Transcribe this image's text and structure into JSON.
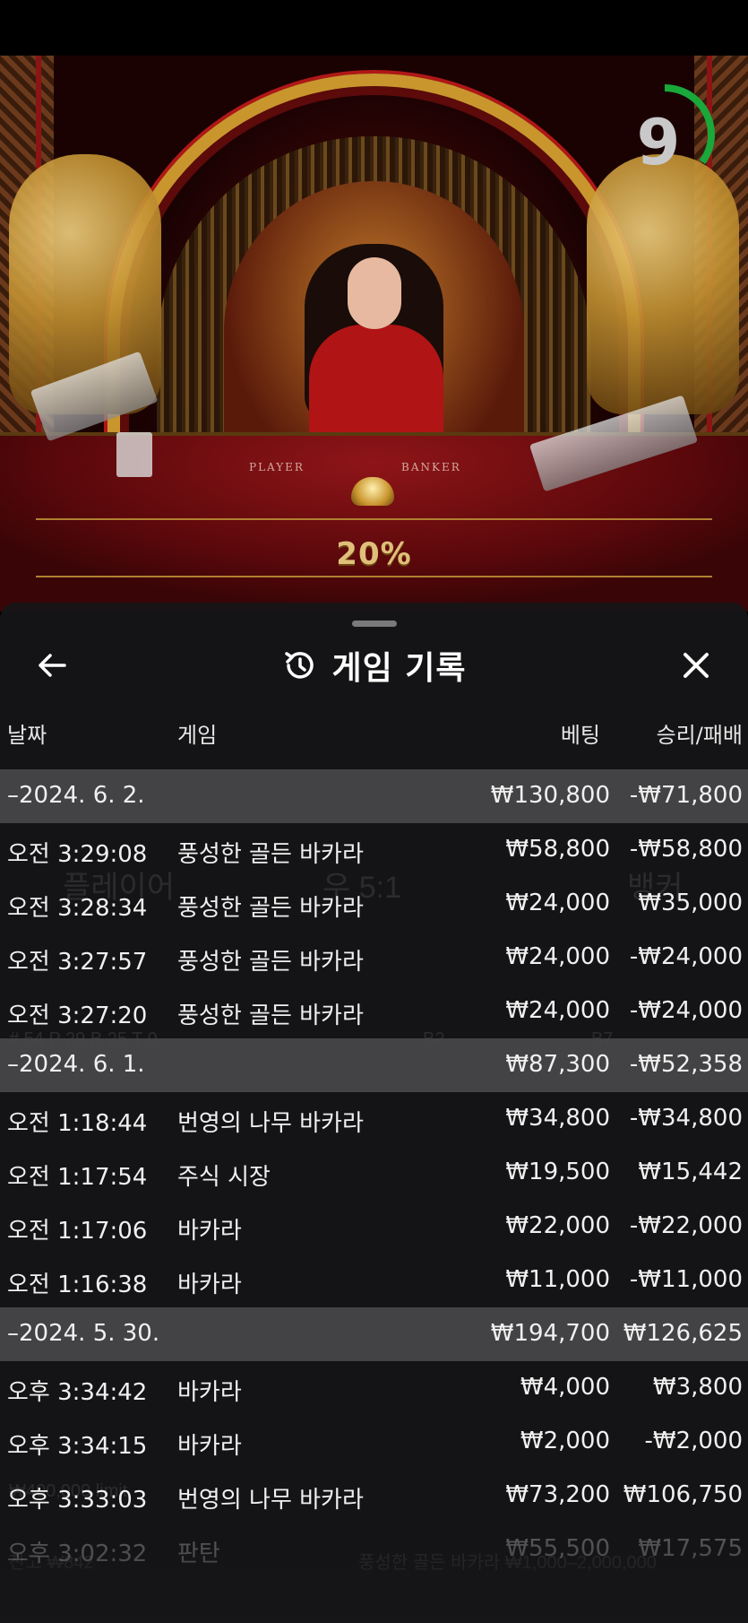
{
  "video": {
    "table_left_label": "PLAYER",
    "table_right_label": "BANKER",
    "bonus_label": "20%",
    "timer_value": "9",
    "timer_progress": 0.35,
    "timer_color": "#19a83a"
  },
  "history": {
    "title": "게임 기록",
    "columns": {
      "date": "날짜",
      "game": "게임",
      "bet": "베팅",
      "win_loss": "승리/패배"
    },
    "rows": [
      {
        "type": "group",
        "date": "–2024. 6. 2.",
        "game": "",
        "bet": "₩130,800",
        "wl": "-₩71,800"
      },
      {
        "type": "item",
        "date": "오전 3:29:08",
        "game": "풍성한 골든 바카라",
        "bet": "₩58,800",
        "wl": "-₩58,800"
      },
      {
        "type": "item",
        "date": "오전 3:28:34",
        "game": "풍성한 골든 바카라",
        "bet": "₩24,000",
        "wl": "₩35,000"
      },
      {
        "type": "item",
        "date": "오전 3:27:57",
        "game": "풍성한 골든 바카라",
        "bet": "₩24,000",
        "wl": "-₩24,000"
      },
      {
        "type": "item",
        "date": "오전 3:27:20",
        "game": "풍성한 골든 바카라",
        "bet": "₩24,000",
        "wl": "-₩24,000"
      },
      {
        "type": "group",
        "date": "–2024. 6. 1.",
        "game": "",
        "bet": "₩87,300",
        "wl": "-₩52,358"
      },
      {
        "type": "item",
        "date": "오전 1:18:44",
        "game": "번영의 나무 바카라",
        "bet": "₩34,800",
        "wl": "-₩34,800"
      },
      {
        "type": "item",
        "date": "오전 1:17:54",
        "game": "주식 시장",
        "bet": "₩19,500",
        "wl": "₩15,442"
      },
      {
        "type": "item",
        "date": "오전 1:17:06",
        "game": "바카라",
        "bet": "₩22,000",
        "wl": "-₩22,000"
      },
      {
        "type": "item",
        "date": "오전 1:16:38",
        "game": "바카라",
        "bet": "₩11,000",
        "wl": "-₩11,000"
      },
      {
        "type": "group",
        "date": "–2024. 5. 30.",
        "game": "",
        "bet": "₩194,700",
        "wl": "₩126,625"
      },
      {
        "type": "item",
        "date": "오후 3:34:42",
        "game": "바카라",
        "bet": "₩4,000",
        "wl": "₩3,800"
      },
      {
        "type": "item",
        "date": "오후 3:34:15",
        "game": "바카라",
        "bet": "₩2,000",
        "wl": "-₩2,000"
      },
      {
        "type": "item",
        "date": "오후 3:33:03",
        "game": "번영의 나무 바카라",
        "bet": "₩73,200",
        "wl": "₩106,750"
      },
      {
        "type": "item",
        "dim": true,
        "date": "오후 3:02:32",
        "game": "판탄",
        "bet": "₩55,500",
        "wl": "₩17,575"
      }
    ]
  },
  "background_ghost": {
    "player_label": "플레이어",
    "ratio": "우 5:1",
    "banker_label": "뱅커",
    "stats": "# 54   P 29   B 25   T 0",
    "b2": "B2",
    "b7": "B7",
    "limit": "₩400,000 limit",
    "balance": "잔고 ₩842",
    "table_info": "풍성한 골든 바카라 ₩1,000–2,000,000"
  }
}
